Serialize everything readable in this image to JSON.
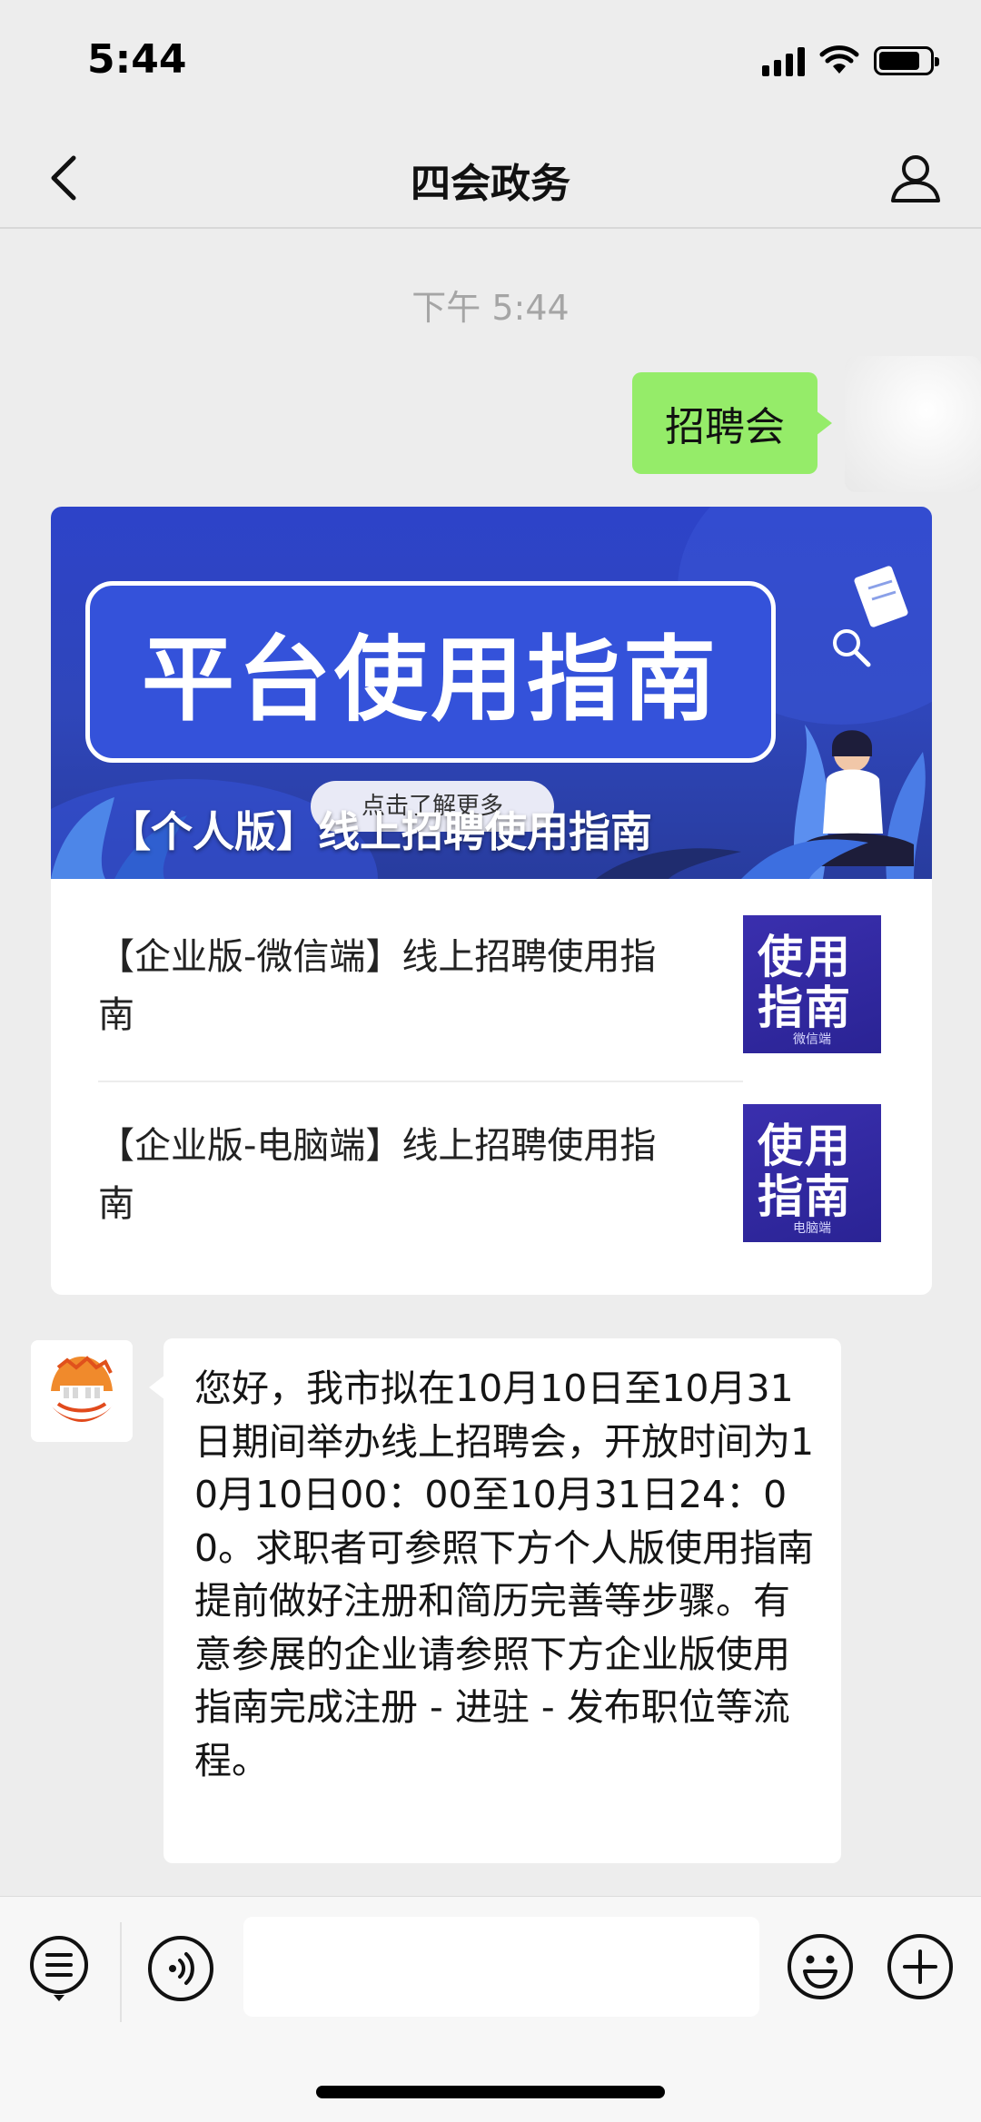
{
  "status_bar": {
    "time": "5:44",
    "battery_level": 0.82,
    "icons": [
      "signal-icon",
      "wifi-icon",
      "battery-icon"
    ]
  },
  "nav": {
    "title": "四会政务",
    "back_icon": "chevron-left-icon",
    "profile_icon": "person-icon"
  },
  "chat": {
    "timestamp": "下午 5:44",
    "sent_message": "招聘会",
    "article": {
      "cover_title": "平台使用指南",
      "cover_button": "点击了解更多",
      "cover_caption": "【个人版】线上招聘使用指南",
      "items": [
        {
          "title": "【企业版-微信端】线上招聘使用指南",
          "thumb_line1": "使用",
          "thumb_line2": "指南",
          "thumb_sub": "微信端"
        },
        {
          "title": "【企业版-电脑端】线上招聘使用指南",
          "thumb_line1": "使用",
          "thumb_line2": "指南",
          "thumb_sub": "电脑端"
        }
      ]
    },
    "received_message": "您好，我市拟在10月10日至10月31日期间举办线上招聘会，开放时间为10月10日00：00至10月31日24：00。求职者可参照下方个人版使用指南提前做好注册和简历完善等步骤。有意参展的企业请参照下方企业版使用指南完成注册 - 进驻 - 发布职位等流程。"
  },
  "input_bar": {
    "input_value": "",
    "icons": [
      "menu-list-icon",
      "voice-icon",
      "emoji-icon",
      "plus-icon"
    ]
  },
  "colors": {
    "background": "#ededed",
    "sent_bubble": "#95ec69",
    "cover_blue": "#2f46ba"
  }
}
